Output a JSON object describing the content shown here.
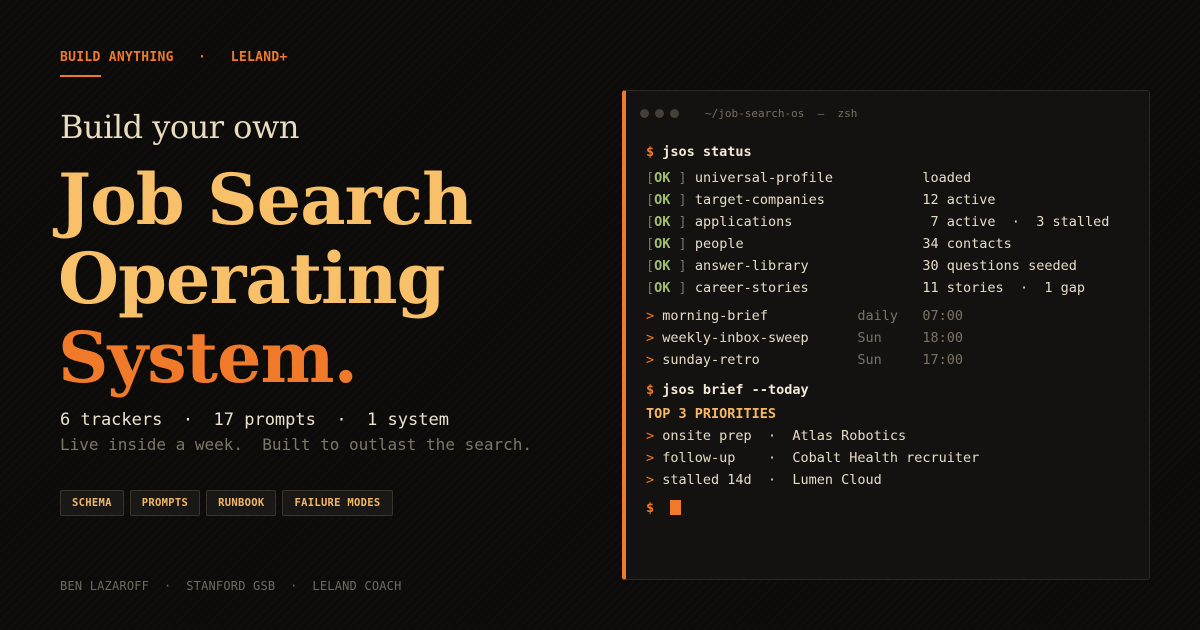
{
  "eyebrow": {
    "left": "BUILD ANYTHING",
    "sep": "·",
    "right": "LELAND+"
  },
  "hero": {
    "kicker": "Build your own",
    "line1": "Job Search",
    "line2": "Operating",
    "line3": "System."
  },
  "stats": "6 trackers  ·  17 prompts  ·  1 system",
  "tagline": "Live inside a week.  Built to outlast the search.",
  "tags": [
    "SCHEMA",
    "PROMPTS",
    "RUNBOOK",
    "FAILURE MODES"
  ],
  "footer": "BEN LAZAROFF  ·  STANFORD GSB  ·  LELAND COACH",
  "terminal": {
    "title": "~/job-search-os  —  zsh",
    "prompt_symbol": "$",
    "ok_label": "OK",
    "arrow": ">",
    "cmd1": "jsos status",
    "status_rows": [
      {
        "name": "universal-profile",
        "value": "loaded"
      },
      {
        "name": "target-companies",
        "value": "12 active"
      },
      {
        "name": "applications",
        "value": " 7 active  ·  3 stalled"
      },
      {
        "name": "people",
        "value": "34 contacts"
      },
      {
        "name": "answer-library",
        "value": "30 questions seeded"
      },
      {
        "name": "career-stories",
        "value": "11 stories  ·  1 gap"
      }
    ],
    "schedule_rows": [
      {
        "name": "morning-brief",
        "when": "daily",
        "time": "07:00"
      },
      {
        "name": "weekly-inbox-sweep",
        "when": "Sun",
        "time": "18:00"
      },
      {
        "name": "sunday-retro",
        "when": "Sun",
        "time": "17:00"
      }
    ],
    "cmd2": "jsos brief --today",
    "priorities_heading": "TOP 3 PRIORITIES",
    "priorities": [
      {
        "type": "onsite prep",
        "detail": "Atlas Robotics"
      },
      {
        "type": "follow-up",
        "detail": "Cobalt Health recruiter"
      },
      {
        "type": "stalled 14d",
        "detail": "Lumen Cloud"
      }
    ]
  },
  "colors": {
    "accent": "#f07a2a",
    "gold": "#f8c069",
    "ok_green": "#a0c070",
    "background": "#0c0b0a",
    "terminal_bg": "#131211"
  }
}
